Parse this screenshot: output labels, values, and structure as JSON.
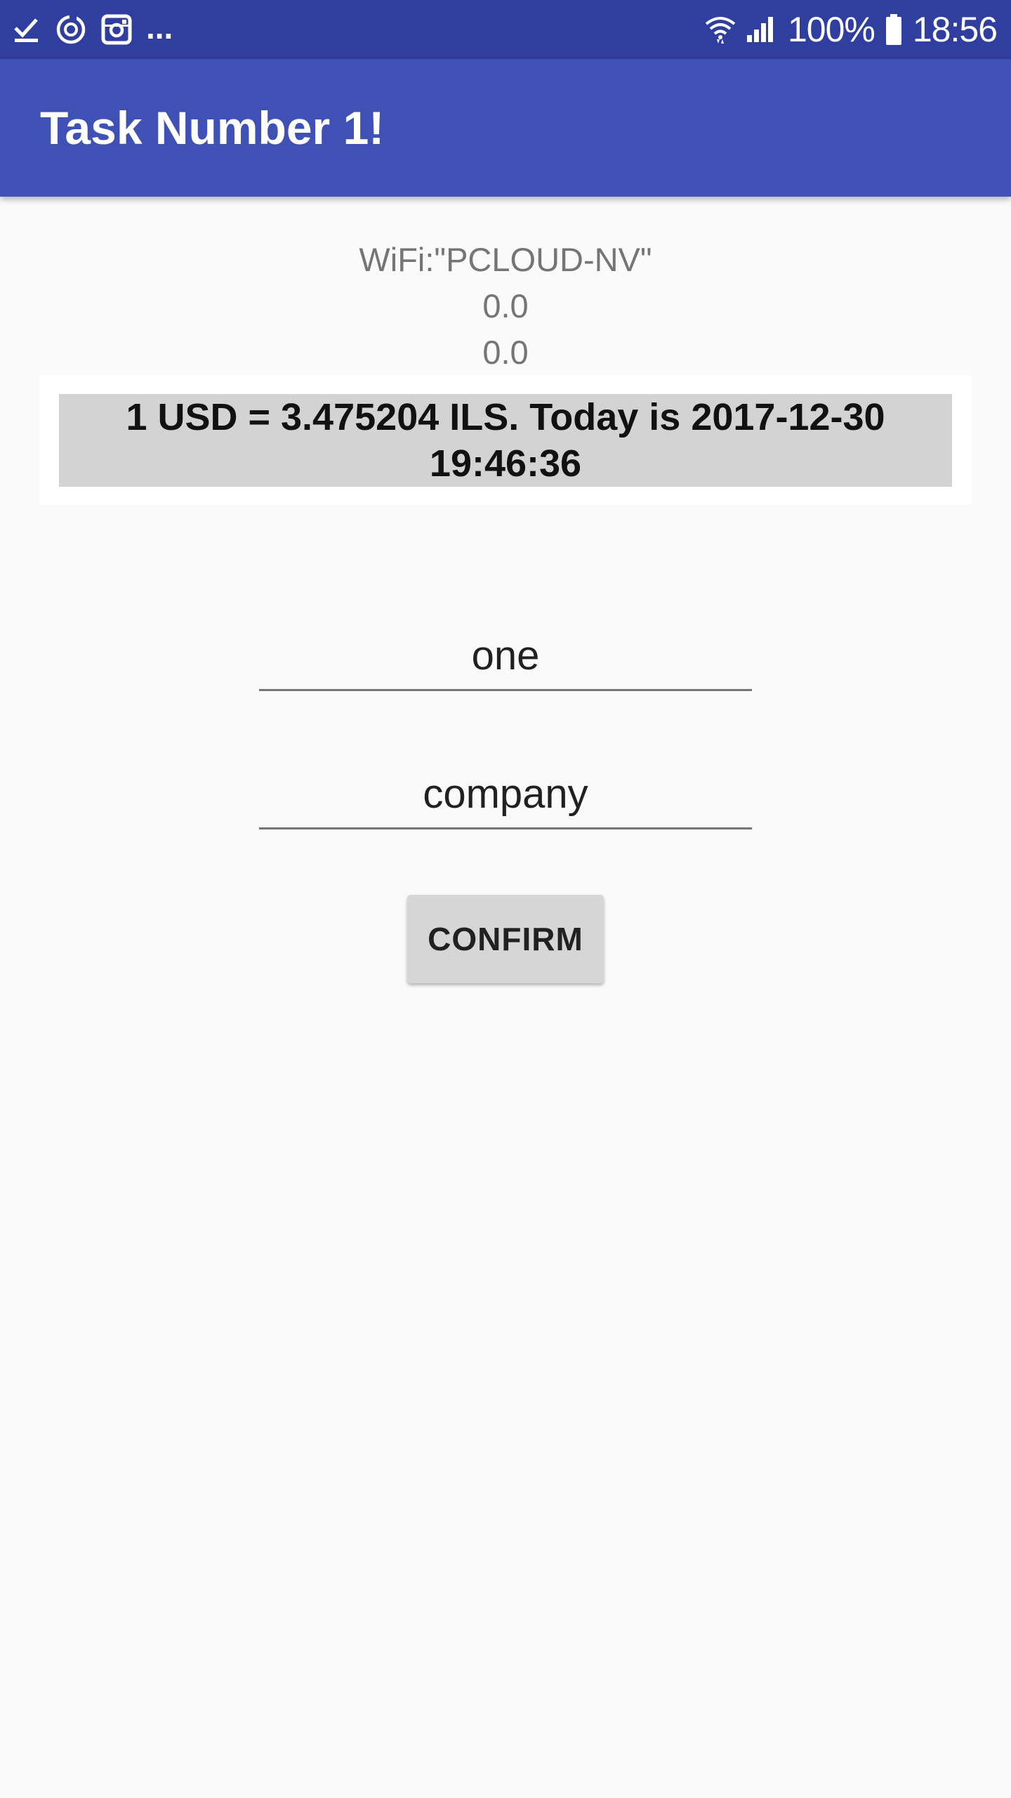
{
  "status_bar": {
    "notification_icons": [
      "checkmark-icon",
      "sync-icon",
      "instagram-icon"
    ],
    "more_indicator": "...",
    "battery_percent": "100%",
    "time": "18:56"
  },
  "app_bar": {
    "title": "Task Number 1!"
  },
  "info": {
    "wifi": "WiFi:\"PCLOUD-NV\"",
    "value_1": "0.0",
    "value_2": "0.0"
  },
  "rate": {
    "text": "1 USD = 3.475204 ILS. Today is 2017-12-30 19:46:36"
  },
  "form": {
    "field_1_value": "one",
    "field_2_value": "company",
    "confirm_label": "CONFIRM"
  },
  "colors": {
    "status_bar": "#303f9f",
    "app_bar": "#3f51b5",
    "background": "#fafafa",
    "rate_box": "#d3d3d3",
    "button": "#d6d6d6"
  }
}
